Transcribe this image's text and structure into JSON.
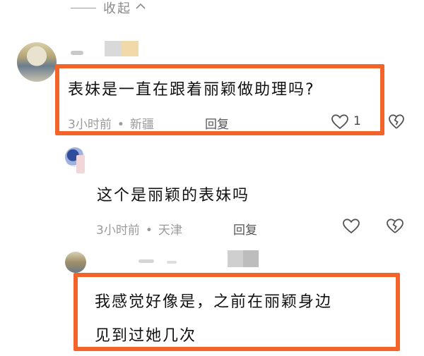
{
  "collapse": {
    "label": "收起"
  },
  "comments": [
    {
      "text": "表妹是一直在跟着丽颖做助理吗?",
      "time": "3小时前",
      "separator": "•",
      "location": "新疆",
      "reply_label": "回复",
      "likes": "1"
    },
    {
      "text": "这个是丽颖的表妹吗",
      "time": "3小时前",
      "separator": "•",
      "location": "天津",
      "reply_label": "回复"
    },
    {
      "text_line1": "我感觉好像是，之前在丽颖身边",
      "text_line2": "见到过她几次"
    }
  ],
  "colors": {
    "highlight": "#f2642a",
    "meta": "#9a9a9a"
  },
  "icons": [
    "chevron-up-icon",
    "heart-icon",
    "broken-heart-icon"
  ]
}
